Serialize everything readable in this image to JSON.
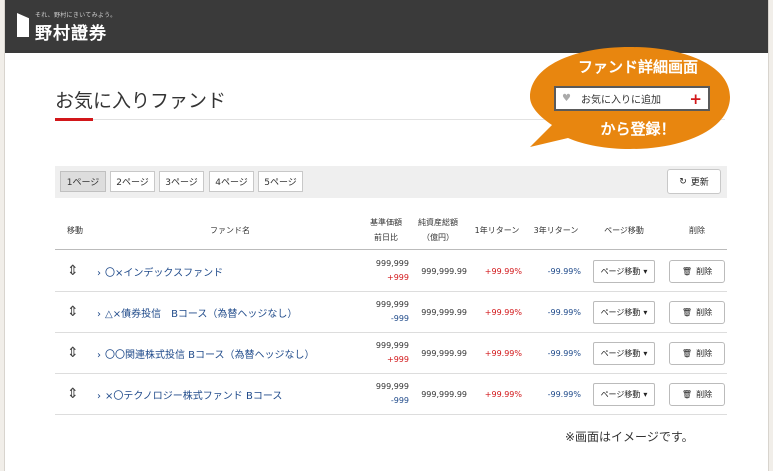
{
  "header": {
    "tagline": "それ、野村にきいてみよう。",
    "brand": "野村證券"
  },
  "page": {
    "title": "お気に入りファンド"
  },
  "pagination": {
    "tabs": [
      "1ページ",
      "2ページ",
      "3ページ",
      "4ページ",
      "5ページ"
    ],
    "active_index": 0,
    "refresh_label": "更新"
  },
  "table": {
    "headers": {
      "move": "移動",
      "fund_name": "ファンド名",
      "nav_line1": "基準価額",
      "nav_line2": "前日比",
      "assets_line1": "純資産総額",
      "assets_line2": "（億円）",
      "return_1y": "1年リターン",
      "return_3y": "3年リターン",
      "page_move": "ページ移動",
      "delete": "削除"
    },
    "rows": [
      {
        "name": "〇×インデックスファンド",
        "nav": "999,999",
        "diff": "+999",
        "diff_sign": "pos",
        "assets": "999,999.99",
        "return_1y": "+99.99%",
        "return_3y": "-99.99%",
        "page_move": "ページ移動",
        "delete": "削除"
      },
      {
        "name": "△×債券投信　Bコース（為替ヘッジなし）",
        "nav": "999,999",
        "diff": "-999",
        "diff_sign": "neg",
        "assets": "999,999.99",
        "return_1y": "+99.99%",
        "return_3y": "-99.99%",
        "page_move": "ページ移動",
        "delete": "削除"
      },
      {
        "name": "〇〇関連株式投信 Bコース（為替ヘッジなし）",
        "nav": "999,999",
        "diff": "+999",
        "diff_sign": "pos",
        "assets": "999,999.99",
        "return_1y": "+99.99%",
        "return_3y": "-99.99%",
        "page_move": "ページ移動",
        "delete": "削除"
      },
      {
        "name": "×〇テクノロジー株式ファンド Bコース",
        "nav": "999,999",
        "diff": "-999",
        "diff_sign": "neg",
        "assets": "999,999.99",
        "return_1y": "+99.99%",
        "return_3y": "-99.99%",
        "page_move": "ページ移動",
        "delete": "削除"
      }
    ]
  },
  "callout": {
    "title": "ファンド詳細画面",
    "button_label": "お気に入りに追加",
    "subtitle": "から登録！"
  },
  "note": "※画面はイメージです。",
  "icons": {
    "move": "up-down-arrows-icon",
    "chevron": "chevron-right-icon",
    "trash": "trash-icon",
    "refresh": "refresh-icon",
    "heart": "heart-icon",
    "plus": "plus-icon",
    "dropdown": "caret-down-icon"
  },
  "colors": {
    "header_bg": "#3a3a3a",
    "accent_red": "#d2171a",
    "link_blue": "#1f4a8a",
    "callout_orange": "#e8860f"
  }
}
